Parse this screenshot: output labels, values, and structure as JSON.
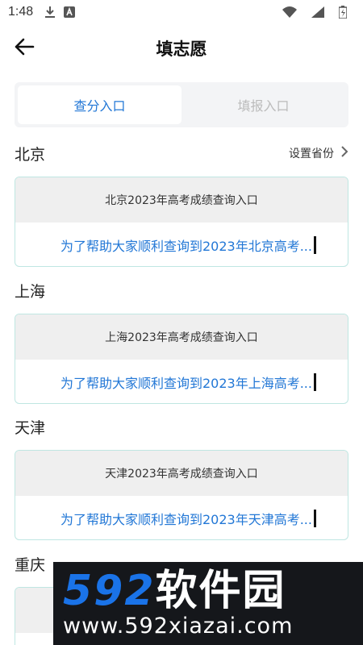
{
  "status_bar": {
    "time": "1:48",
    "icons": [
      "download-icon",
      "a-box-icon",
      "wifi-icon",
      "signal-icon",
      "battery-icon"
    ]
  },
  "header": {
    "title": "填志愿",
    "back_icon": "arrow-left-icon"
  },
  "tabs": [
    {
      "label": "查分入口",
      "active": true
    },
    {
      "label": "填报入口",
      "active": false
    }
  ],
  "sections": [
    {
      "region": "北京",
      "action_label": "设置省份",
      "card_title": "北京2023年高考成绩查询入口",
      "card_text": "为了帮助大家顺利查询到2023年北京高考..."
    },
    {
      "region": "上海",
      "card_title": "上海2023年高考成绩查询入口",
      "card_text": "为了帮助大家顺利查询到2023年上海高考..."
    },
    {
      "region": "天津",
      "card_title": "天津2023年高考成绩查询入口",
      "card_text": "为了帮助大家顺利查询到2023年天津高考..."
    },
    {
      "region": "重庆"
    }
  ],
  "watermark": {
    "brand_number": "592",
    "brand_cn": "软件园",
    "url": "www.592xiazai.com"
  },
  "colors": {
    "accent": "#2277d6",
    "card_border": "#bfe6e2",
    "tab_bg": "#f3f4f6",
    "watermark_blue": "#1a73e8"
  }
}
